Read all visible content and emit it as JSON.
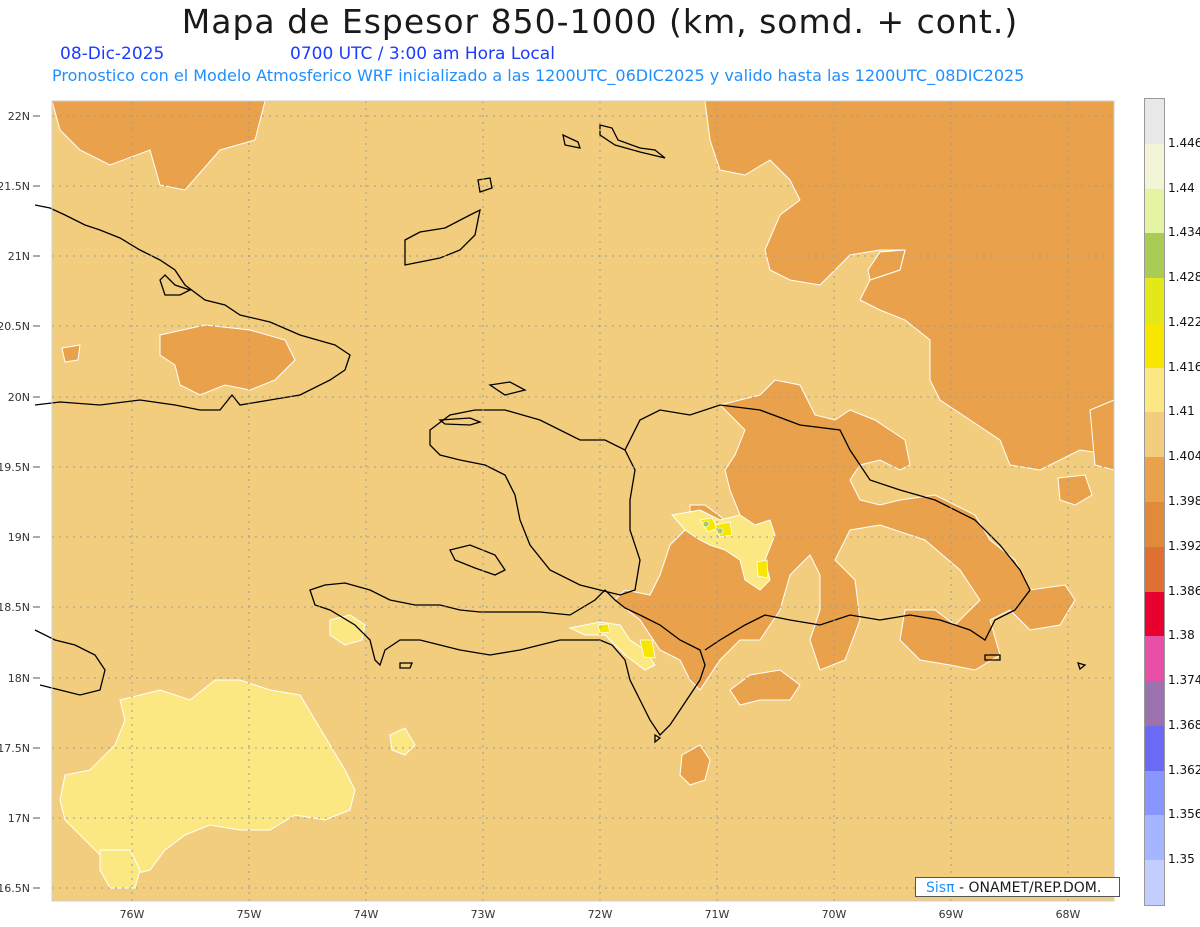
{
  "header": {
    "title": "Mapa de Espesor 850-1000 (km, somd. + cont.)",
    "date": "08-Dic-2025",
    "time": "0700 UTC / 3:00 am Hora Local",
    "description": "Pronostico con el Modelo Atmosferico WRF inicializado a las 1200UTC_06DIC2025 y valido hasta las  1200UTC_08DIC2025"
  },
  "axes": {
    "lat_labels": [
      "22N",
      "21.5N",
      "21N",
      "20.5N",
      "20N",
      "19.5N",
      "19N",
      "18.5N",
      "18N",
      "17.5N",
      "17N",
      "16.5N"
    ],
    "lon_labels": [
      "76W",
      "75W",
      "74W",
      "73W",
      "72W",
      "71W",
      "70W",
      "69W",
      "68W"
    ]
  },
  "legend": {
    "labels": [
      "1.446",
      "1.44",
      "1.434",
      "1.428",
      "1.422",
      "1.416",
      "1.41",
      "1.404",
      "1.398",
      "1.392",
      "1.386",
      "1.38",
      "1.374",
      "1.368",
      "1.362",
      "1.356",
      "1.35"
    ],
    "colors": [
      "#e8e8e8",
      "#f3f5d6",
      "#e4f4a2",
      "#aacc55",
      "#e2e81a",
      "#f7e600",
      "#fbe883",
      "#f2cd7d",
      "#e9a24b",
      "#e18a3a",
      "#de7034",
      "#e8002e",
      "#e850a8",
      "#9b72ad",
      "#6a6af5",
      "#8896ff",
      "#a3b6ff",
      "#c3ceff"
    ],
    "palette": {
      "background": "#f2cd7d",
      "orange": "#e9a24b",
      "light_yellow": "#fbe883",
      "yellow": "#f7e600",
      "green": "#aacc55"
    }
  },
  "credit": {
    "brand": "Sisπ",
    "text": " - ONAMET/REP.DOM."
  }
}
